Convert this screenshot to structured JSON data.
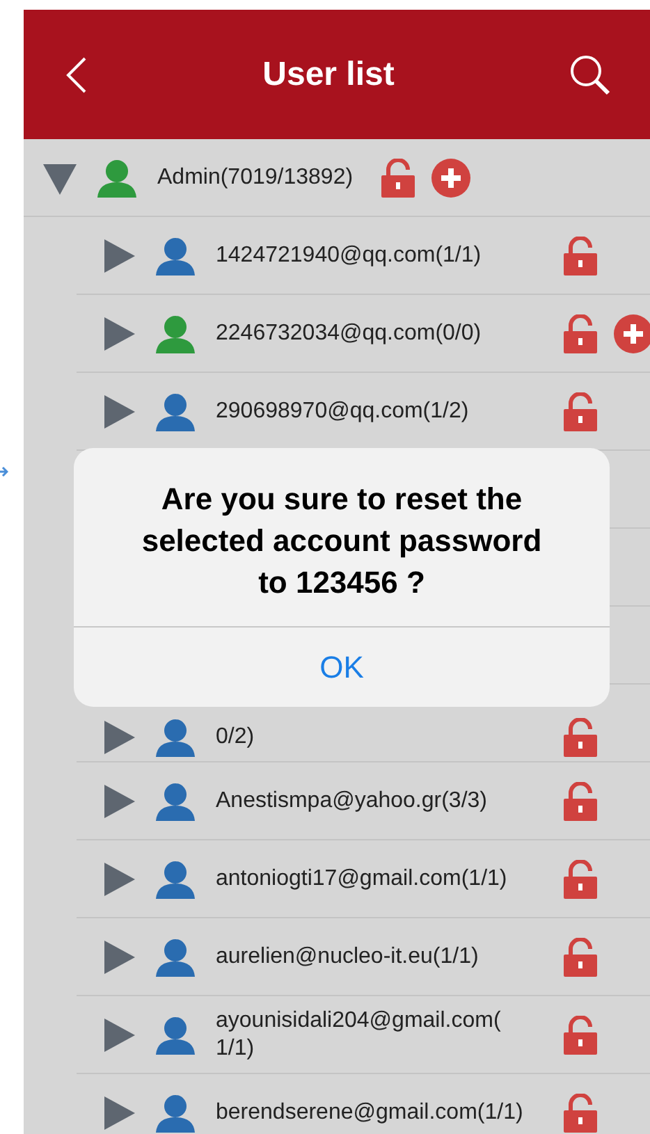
{
  "header": {
    "title": "User list"
  },
  "tree": [
    {
      "label": "Admin(7019/13892)",
      "color": "#2e9a3e",
      "expanded": true,
      "add_button": true,
      "children": [
        {
          "label": "1424721940@qq.com(1/1)",
          "color": "#2a6cb0",
          "expanded": false,
          "add_button": false
        },
        {
          "label": "2246732034@qq.com(0/0)",
          "color": "#2e9a3e",
          "expanded": false,
          "add_button": true
        },
        {
          "label": "290698970@qq.com(1/2)",
          "color": "#2a6cb0",
          "expanded": false,
          "add_button": false
        },
        {
          "kind": "covered"
        },
        {
          "kind": "covered"
        },
        {
          "kind": "covered"
        },
        {
          "kind": "partial",
          "label": "0/2)",
          "color": "#2a6cb0",
          "expanded": false,
          "add_button": false
        },
        {
          "label": "Anestismpa@yahoo.gr(3/3)",
          "color": "#2a6cb0",
          "expanded": false,
          "add_button": false
        },
        {
          "label": "antoniogti17@gmail.com(1/1)",
          "color": "#2a6cb0",
          "expanded": false,
          "add_button": false
        },
        {
          "label": "aurelien@nucleo-it.eu(1/1)",
          "color": "#2a6cb0",
          "expanded": false,
          "add_button": false
        },
        {
          "label": "ayounisidali204@gmail.com( 1/1)",
          "color": "#2a6cb0",
          "expanded": false,
          "add_button": false
        },
        {
          "label": "berendserene@gmail.com(1/1)",
          "color": "#2a6cb0",
          "expanded": false,
          "add_button": false
        }
      ]
    }
  ],
  "dialog": {
    "message": "Are you sure to reset the selected account password to 123456 ?",
    "button": "OK"
  }
}
